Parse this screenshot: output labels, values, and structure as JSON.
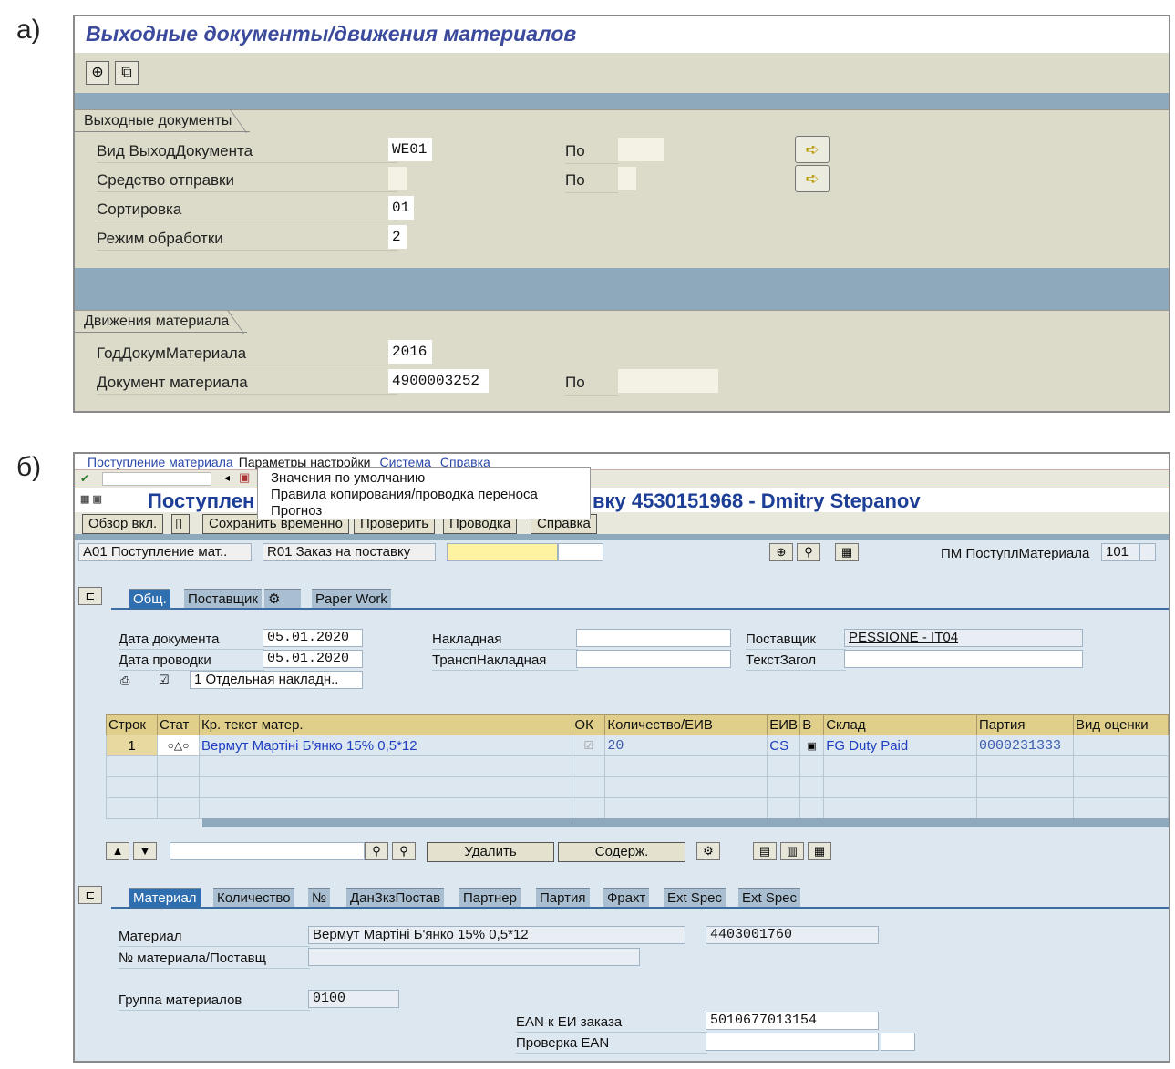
{
  "labels": {
    "a": "а)",
    "b": "б)"
  },
  "panelA": {
    "title": "Выходные документы/движения материалов",
    "toolbar_icons": [
      "execute-icon",
      "copy-variant-icon"
    ],
    "group1": {
      "title": "Выходные документы",
      "rows": [
        {
          "label": "Вид ВыходДокумента",
          "value": "WE01",
          "to_label": "По",
          "to_value": ""
        },
        {
          "label": "Средство отправки",
          "value": "",
          "to_label": "По",
          "to_value": ""
        },
        {
          "label": "Сортировка",
          "value": "01"
        },
        {
          "label": "Режим обработки",
          "value": "2"
        }
      ]
    },
    "group2": {
      "title": "Движения материала",
      "rows": [
        {
          "label": "ГодДокумМатериала",
          "value": "2016"
        },
        {
          "label": "Документ материала",
          "value": "4900003252",
          "to_label": "По",
          "to_value": ""
        }
      ]
    }
  },
  "panelB": {
    "menu": [
      "Поступление материала",
      "Параметры настройки",
      "Система",
      "Справка"
    ],
    "dropdown_items": [
      "Значения по умолчанию",
      "Правила копирования/проводка переноса",
      "Прогноз"
    ],
    "title": "Поступление материала Заказ на поставку 4530151968 - Dmitry Stepanov",
    "title_visible_left": "Поступлен",
    "title_visible_right": "вку 4530151968 - Dmitry Stepanov",
    "app_buttons": [
      "Обзор вкл.",
      "Сохранить временно",
      "Проверить",
      "Проводка",
      "Справка"
    ],
    "selector1": "A01 Поступление мат..",
    "selector2": "R01 Заказ на поставку",
    "pm_label": "ПМ ПоступлМатериала",
    "pm_value": "101",
    "header_tabs": [
      "Общ.",
      "Поставщик",
      "Paper Work"
    ],
    "doc_date_label": "Дата документа",
    "doc_date": "05.01.2020",
    "post_date_label": "Дата проводки",
    "post_date": "05.01.2020",
    "print_option": "1 Отдельная накладн..",
    "invoice_label": "Накладная",
    "trans_invoice_label": "ТранспНакладная",
    "vendor_label": "Поставщик",
    "vendor_value": "PESSIONE - IT04",
    "header_text_label": "ТекстЗагол",
    "table_headers": [
      "Строк",
      "Стат",
      "Кр. текст матер.",
      "ОК",
      "Количество/ЕИВ",
      "ЕИВ",
      "В",
      "Склад",
      "Партия",
      "Вид оценки"
    ],
    "table_rows": [
      {
        "line": "1",
        "status": "○△○",
        "text": "Вермут Мартіні Б'янко 15% 0,5*12",
        "qty": "20",
        "uom": "CS",
        "storage": "FG Duty Paid",
        "batch": "0000231333"
      }
    ],
    "item_buttons": [
      "Удалить",
      "Содерж."
    ],
    "item_tabs": [
      "Материал",
      "Количество",
      "№",
      "ДанЗкзПостав",
      "Партнер",
      "Партия",
      "Фрахт",
      "Ext Spec",
      "Ext Spec"
    ],
    "material_label": "Материал",
    "material_text": "Вермут Мартіні Б'янко 15% 0,5*12",
    "material_number": "4403001760",
    "vendor_mat_label": "№ материала/Поставщ",
    "mat_group_label": "Группа материалов",
    "mat_group_value": "0100",
    "ean_label": "EAN к ЕИ заказа",
    "ean_value": "5010677013154",
    "ean_check_label": "Проверка EAN"
  }
}
